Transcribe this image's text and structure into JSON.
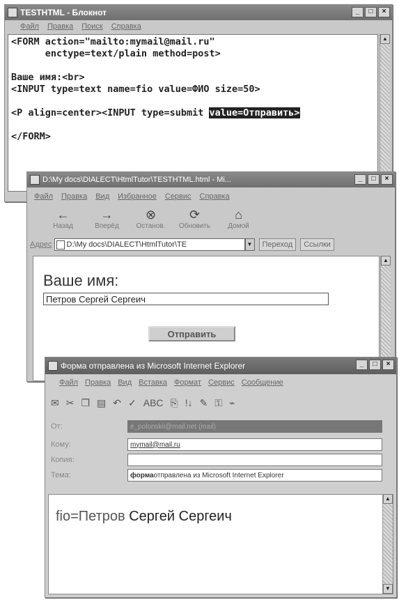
{
  "notepad": {
    "title": "TESTHTML - Блокнот",
    "menu": [
      "Файл",
      "Правка",
      "Поиск",
      "Справка"
    ],
    "lines": [
      "<FORM action=\"mailto:mymail@mail.ru\"",
      "      enctype=text/plain method=post>",
      "",
      "Ваше имя:<br>",
      "<INPUT type=text name=fio value=ФИО size=50>",
      "",
      "<P align=center><INPUT type=submit ",
      "",
      "</FORM>"
    ],
    "selected_text": "value=Отправить>"
  },
  "ie": {
    "title": "D:\\My docs\\DIALECT\\HtmlTutor\\TESTHTML.html - Mi...",
    "menu": [
      "Файл",
      "Правка",
      "Вид",
      "Избранное",
      "Сервис",
      "Справка"
    ],
    "toolbar": [
      {
        "label": "Назад",
        "icon": "back-arrow-icon",
        "glyph": "←"
      },
      {
        "label": "Вперёд",
        "icon": "forward-arrow-icon",
        "glyph": "→"
      },
      {
        "label": "Останов.",
        "icon": "stop-icon",
        "glyph": "⊗"
      },
      {
        "label": "Обновить",
        "icon": "refresh-icon",
        "glyph": "⟳"
      },
      {
        "label": "Домой",
        "icon": "home-icon",
        "glyph": "⌂"
      }
    ],
    "address_label": "Адрес",
    "address_value": "D:\\My docs\\DIALECT\\HtmlTutor\\TE",
    "go_label": "Переход",
    "links_label": "Ссылки",
    "page_label": "Ваше имя:",
    "input_value": "Петров Сергей Сергеич",
    "submit_label": "Отправить"
  },
  "mail": {
    "title": "Форма отправлена из Microsoft Internet Explorer",
    "menu": [
      "Файл",
      "Правка",
      "Вид",
      "Вставка",
      "Формат",
      "Сервис",
      "Сообщение"
    ],
    "fields": {
      "from_label": "От:",
      "from_value": "e_polonskii@mail.net   (mail)",
      "to_label": "Кому:",
      "to_value": "mymail@mail.ru",
      "cc_label": "Копия:",
      "cc_value": "",
      "subject_label": "Тема:",
      "subject_bold": "форма",
      "subject_rest": " отправлена из Microsoft Internet Explorer"
    },
    "body_key": "fio=Петров",
    "body_rest": " Сергей Сергеич"
  }
}
